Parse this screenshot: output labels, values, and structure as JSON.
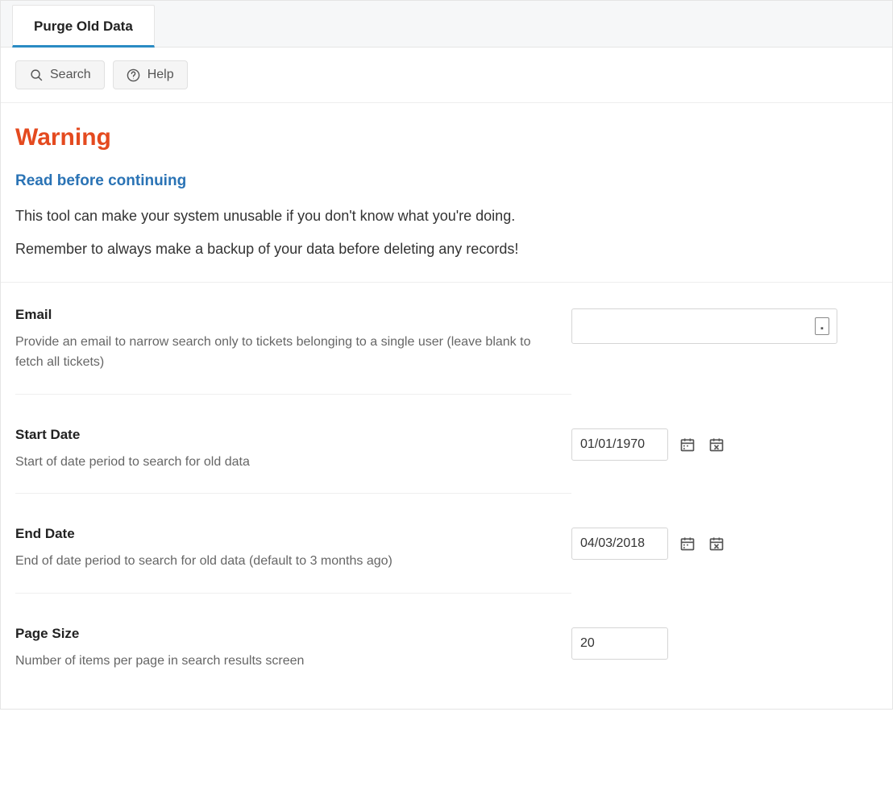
{
  "tab": {
    "label": "Purge Old Data"
  },
  "toolbar": {
    "search_label": "Search",
    "help_label": "Help"
  },
  "warning": {
    "title": "Warning",
    "subtitle": "Read before continuing",
    "line1": "This tool can make your system unusable if you don't know what you're doing.",
    "line2": "Remember to always make a backup of your data before deleting any records!"
  },
  "fields": {
    "email": {
      "label": "Email",
      "help": "Provide an email to narrow search only to tickets belonging to a single user (leave blank to fetch all tickets)",
      "value": ""
    },
    "start_date": {
      "label": "Start Date",
      "help": "Start of date period to search for old data",
      "value": "01/01/1970"
    },
    "end_date": {
      "label": "End Date",
      "help": "End of date period to search for old data (default to 3 months ago)",
      "value": "04/03/2018"
    },
    "page_size": {
      "label": "Page Size",
      "help": "Number of items per page in search results screen",
      "value": "20"
    }
  }
}
